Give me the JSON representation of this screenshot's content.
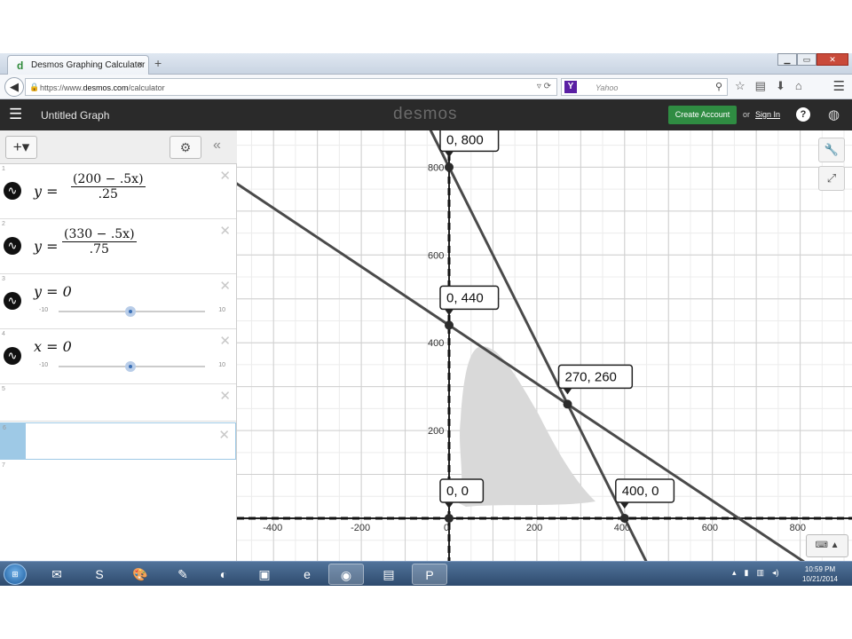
{
  "browser": {
    "tab_title": "Desmos Graphing Calculator",
    "tab_close": "×",
    "new_tab": "+",
    "url_prefix": "https://www.",
    "url_domain": "desmos.com",
    "url_path": "/calculator",
    "search_engine": "Yahoo",
    "window_controls": [
      "▁",
      "▭",
      "✕"
    ]
  },
  "desmos": {
    "title": "Untitled Graph",
    "logo": "desmos",
    "create_account": "Create Account",
    "or": "or",
    "sign_in": "Sign In",
    "help": "?"
  },
  "expressions": [
    {
      "num": "1",
      "lhs": "y =",
      "numerator": "(200 − .5x)",
      "denominator": ".25"
    },
    {
      "num": "2",
      "lhs": "y =",
      "numerator": "(330 − .5x)",
      "denominator": ".75"
    },
    {
      "num": "3",
      "expr": "y = 0",
      "slider_min": "-10",
      "slider_max": "10",
      "slider_value": 0
    },
    {
      "num": "4",
      "expr": "x = 0",
      "slider_min": "-10",
      "slider_max": "10",
      "slider_value": 0
    },
    {
      "num": "5"
    },
    {
      "num": "6"
    },
    {
      "num": "7"
    }
  ],
  "graph": {
    "x_ticks": [
      "-400",
      "-200",
      "0",
      "200",
      "400",
      "600",
      "800"
    ],
    "y_ticks": [
      "200",
      "400",
      "600",
      "800"
    ],
    "points": [
      {
        "label": "0, 800",
        "x": 0,
        "y": 800
      },
      {
        "label": "0, 440",
        "x": 0,
        "y": 440
      },
      {
        "label": "270, 260",
        "x": 270,
        "y": 260
      },
      {
        "label": "0, 0",
        "x": 0,
        "y": 0
      },
      {
        "label": "400, 0",
        "x": 400,
        "y": 0
      }
    ],
    "line_color": "#4a4a4a",
    "shade_color": "#d9d9d9"
  },
  "taskbar": {
    "time": "10:59 PM",
    "date": "10/21/2014"
  }
}
